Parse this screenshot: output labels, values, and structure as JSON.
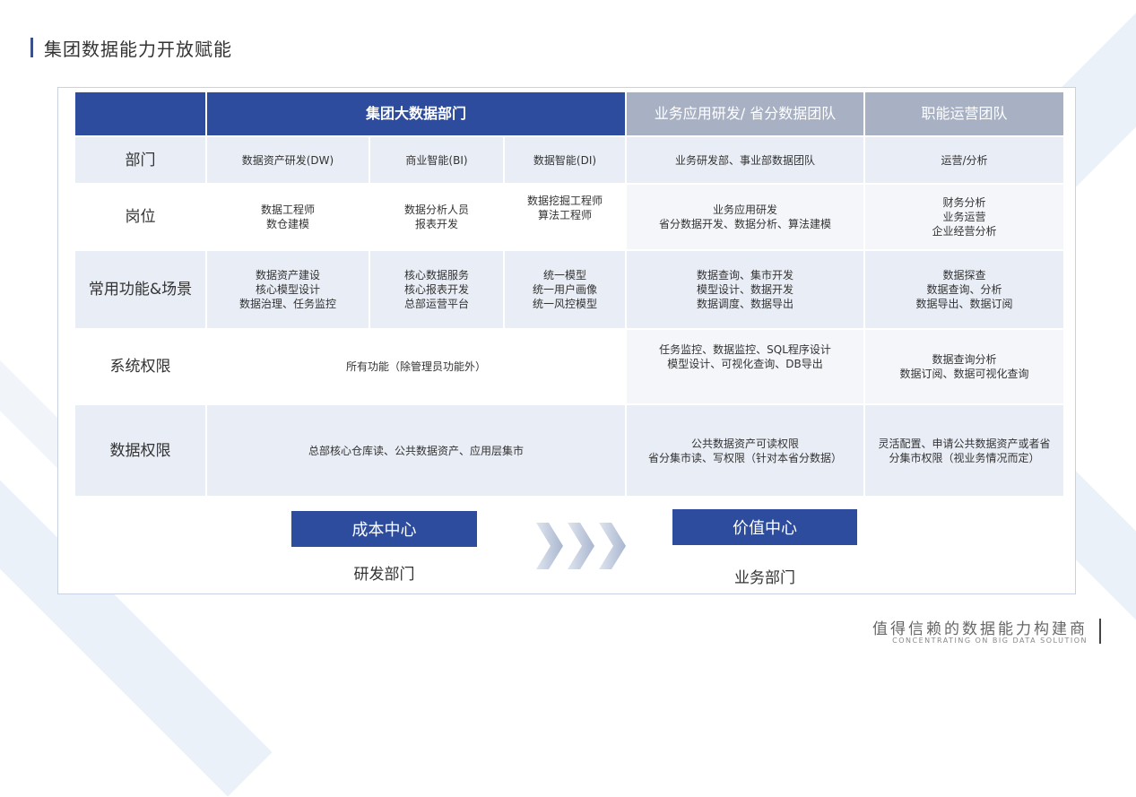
{
  "page_title": "集团数据能力开放赋能",
  "table": {
    "header": {
      "corner": "",
      "group": "集团大数据部门",
      "biz": "业务应用研发/ 省分数据团队",
      "ops": "职能运营团队"
    },
    "rows": {
      "dept": {
        "label": "部门",
        "dw": "数据资产研发(DW)",
        "bi": "商业智能(BI)",
        "di": "数据智能(DI)",
        "biz": "业务研发部、事业部数据团队",
        "ops": "运营/分析"
      },
      "post": {
        "label": "岗位",
        "dw": "数据工程师\n数仓建模",
        "bi": "数据分析人员\n报表开发",
        "di": "数据挖掘工程师\n算法工程师",
        "biz": "业务应用研发\n省分数据开发、数据分析、算法建模",
        "ops": "财务分析\n业务运营\n企业经营分析"
      },
      "scene": {
        "label": "常用功能&场景",
        "dw": "数据资产建设\n核心模型设计\n数据治理、任务监控",
        "bi": "核心数据服务\n核心报表开发\n总部运营平台",
        "di": "统一模型\n统一用户画像\n统一风控模型",
        "biz": "数据查询、集市开发\n模型设计、数据开发\n数据调度、数据导出",
        "ops": "数据探查\n数据查询、分析\n数据导出、数据订阅"
      },
      "sys": {
        "label": "系统权限",
        "group": "所有功能（除管理员功能外）",
        "biz": "任务监控、数据监控、SQL程序设计\n模型设计、可视化查询、DB导出",
        "ops": "数据查询分析\n数据订阅、数据可视化查询"
      },
      "data": {
        "label": "数据权限",
        "group": "总部核心仓库读、公共数据资产、应用层集市",
        "biz": "公共数据资产可读权限\n省分集市读、写权限（针对本省分数据）",
        "ops": "灵活配置、申请公共数据资产或者省分集市权限（视业务情况而定）"
      }
    }
  },
  "flow": {
    "cost_center": "成本中心",
    "cost_dept": "研发部门",
    "value_center": "价值中心",
    "value_dept": "业务部门"
  },
  "footer": {
    "slogan": "值得信赖的数据能力构建商",
    "slogan_en": "CONCENTRATING ON BIG DATA SOLUTION"
  },
  "colors": {
    "header_blue": "#2e4c9e",
    "header_gray": "#a8b1c4",
    "row_bg": "#e9edf5"
  }
}
